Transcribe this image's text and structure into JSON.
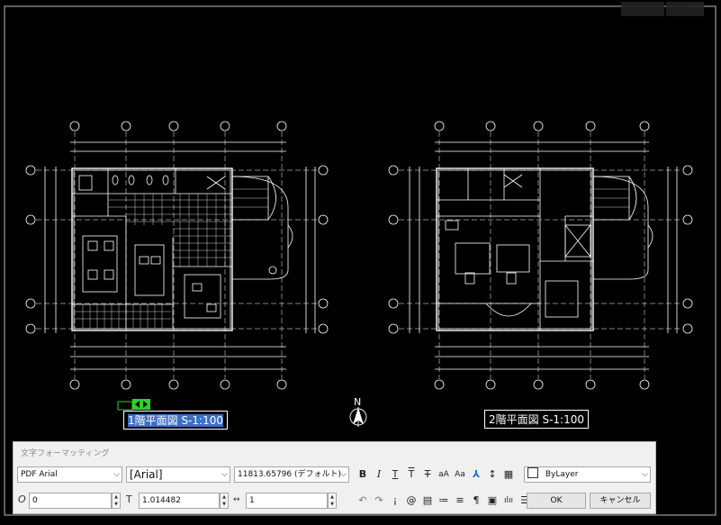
{
  "drawing": {
    "plan1_label_selected": "1階平面図 S-1:100",
    "plan2_label": "2階平面図 S-1:100",
    "north_label": "N"
  },
  "toolbar": {
    "title": "文字フォーマッティング",
    "font_type": "PDF Arial",
    "font_name": "[Arial]",
    "text_height": "11813.65796 (デフォルト)",
    "color_layer": "ByLayer",
    "oblique_angle": "0",
    "width_factor": "1.014482",
    "tracking": "1",
    "ok_label": "OK",
    "cancel_label": "キャンセル"
  },
  "colors": {
    "drawing_lines": "#ffffff",
    "selection_highlight": "#3b6fc4",
    "grip_green": "#2bd22b",
    "toolbar_bg": "#f0f0f0",
    "stack_icon": "#1e6fd0"
  }
}
